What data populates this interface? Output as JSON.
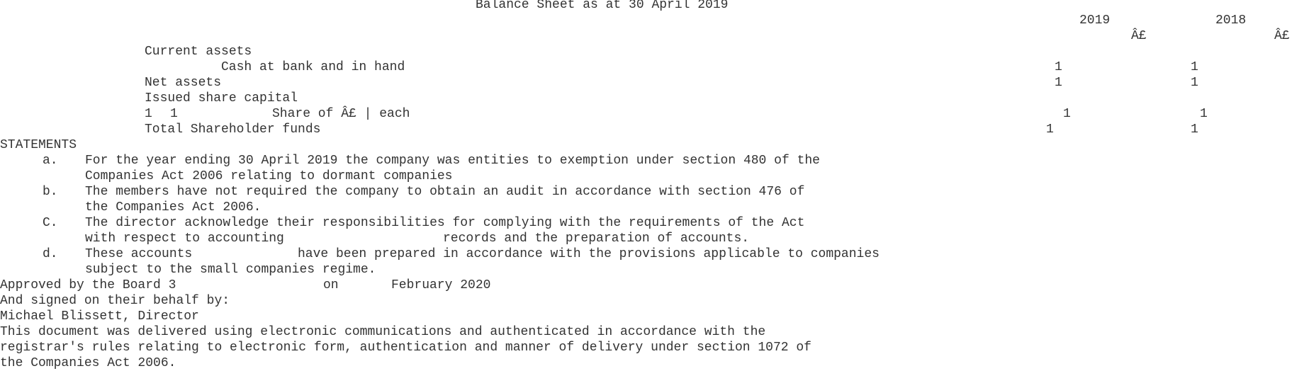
{
  "header": {
    "title": "Balance Sheet as at 30 April 2019",
    "col_2019": "2019",
    "col_2018": "2018",
    "currency_2019": "Â£",
    "currency_2018": "Â£"
  },
  "balance_sheet": {
    "current_assets_label": "Current assets",
    "cash_label": "Cash at bank and in hand",
    "cash_2019": "1",
    "cash_2018": "1",
    "net_assets_label": "Net assets",
    "net_assets_2019": "1",
    "net_assets_2018": "1",
    "issued_share_capital_label": "Issued share capital",
    "share_count_a": "1",
    "share_count_b": "1",
    "share_description": "Share of Â£ | each",
    "share_2019": "1",
    "share_2018": "1",
    "total_funds_label": "Total Shareholder funds",
    "total_funds_2019": "1",
    "total_funds_2018": "1"
  },
  "statements": {
    "heading": "STATEMENTS",
    "items": [
      {
        "marker": "a.",
        "line1": "For the year ending 30 April 2019 the company was entities to exemption under section 480 of the",
        "line2": "Companies Act 2006 relating to dormant companies"
      },
      {
        "marker": "b.",
        "line1": "The members have not required the company to obtain an audit in accordance with section 476 of",
        "line2": "the Companies Act 2006."
      },
      {
        "marker": "C.",
        "line1": "The director acknowledge their responsibilities for complying with the requirements of the Act",
        "line2a": "with respect to accounting",
        "line2b": "records and the preparation of accounts."
      },
      {
        "marker": "d.",
        "line1a": "These accounts",
        "line1b": "have been prepared in accordance with the provisions applicable to companies",
        "line2": "subject to the small companies regime."
      }
    ]
  },
  "approval": {
    "approved_prefix": "Approved by the Board 3",
    "approved_on": "on",
    "approved_date": "February 2020",
    "signed_line": "And signed on their behalf by:",
    "signatory": "Michael Blissett, Director"
  },
  "footer": {
    "line1": "This document was delivered using electronic communications and authenticated in accordance with the",
    "line2": "registrar's rules relating to electronic form, authentication and manner of delivery under section 1072 of",
    "line3": "the Companies Act 2006."
  }
}
